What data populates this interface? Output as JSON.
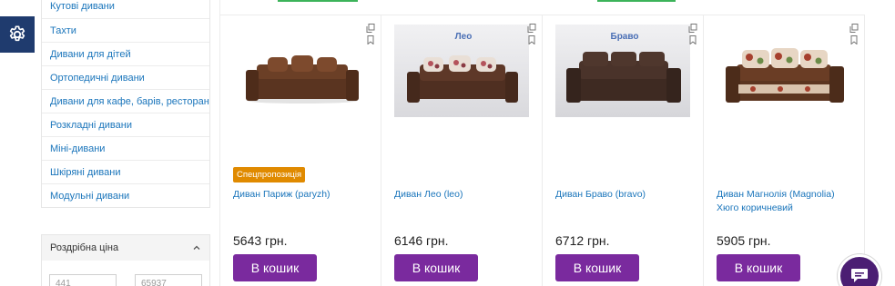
{
  "sidebar": {
    "categories": [
      "Кутові дивани",
      "Тахти",
      "Дивани для дітей",
      "Ортопедичні дивани",
      "Дивани для кафе, барів, ресторанів",
      "Розкладні дивани",
      "Міні-дивани",
      "Шкіряні дивани",
      "Модульні дивани"
    ]
  },
  "filter": {
    "title": "Роздрібна ціна",
    "min": "441",
    "max": "65937"
  },
  "products": [
    {
      "name": "Диван Париж (paryzh)",
      "price": "5643 грн.",
      "badge": "Спецпропозиція",
      "button": "В кошик",
      "image_label": ""
    },
    {
      "name": "Диван Лео (leo)",
      "price": "6146 грн.",
      "badge": "",
      "button": "В кошик",
      "image_label": "Лео"
    },
    {
      "name": "Диван Браво (bravo)",
      "price": "6712 грн.",
      "badge": "",
      "button": "В кошик",
      "image_label": "Браво"
    },
    {
      "name": "Диван Магнолія (Magnolia) Хюго коричневий",
      "price": "5905 грн.",
      "badge": "",
      "button": "В кошик",
      "image_label": ""
    }
  ],
  "colors": {
    "link": "#1a75bb",
    "button": "#7a2a9e",
    "badge": "#e08a00",
    "settings": "#1f3b6e",
    "chat": "#4b1e73"
  },
  "icons": {
    "settings": "gear-icon",
    "compare": "copy-icon",
    "wishlist": "bookmark-icon",
    "chat": "chat-icon",
    "collapse": "chevron-up-icon"
  }
}
